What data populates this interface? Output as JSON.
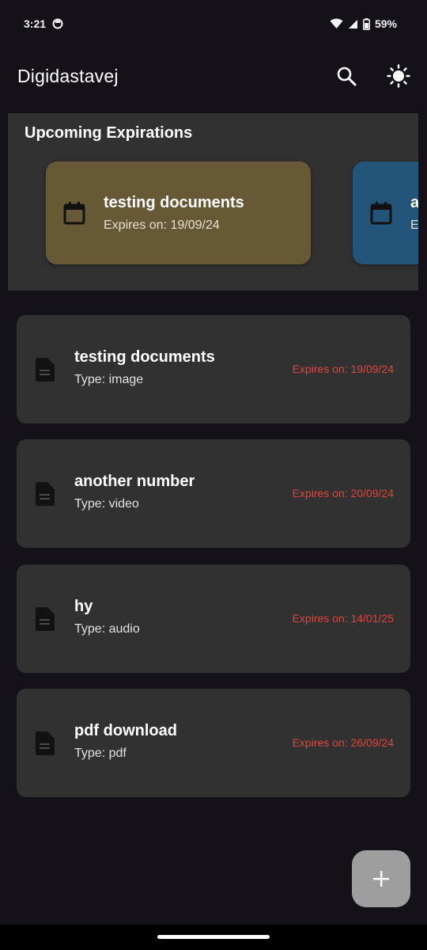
{
  "status_bar": {
    "time": "3:21",
    "battery": "59%"
  },
  "app_bar": {
    "title": "Digidastavej",
    "actions": [
      "search-icon",
      "brightness-icon"
    ]
  },
  "upcoming": {
    "title": "Upcoming Expirations",
    "cards": [
      {
        "name": "testing documents",
        "date": "Expires on: 19/09/24",
        "color": "#675836"
      },
      {
        "name": "a",
        "date": "E",
        "color": "#23557a"
      }
    ]
  },
  "documents": [
    {
      "name": "testing documents",
      "type": "Type: image",
      "expires": "Expires on: 19/09/24"
    },
    {
      "name": "another number",
      "type": "Type: video",
      "expires": "Expires on: 20/09/24"
    },
    {
      "name": "hy",
      "type": "Type: audio",
      "expires": "Expires on: 14/01/25"
    },
    {
      "name": "pdf download",
      "type": "Type: pdf",
      "expires": "Expires on: 26/09/24"
    }
  ],
  "fab": {
    "icon": "add-icon"
  },
  "colors": {
    "background": "#141218",
    "surface": "#313131",
    "expiry_red": "#e0443a",
    "fab": "#9e9e9e"
  }
}
